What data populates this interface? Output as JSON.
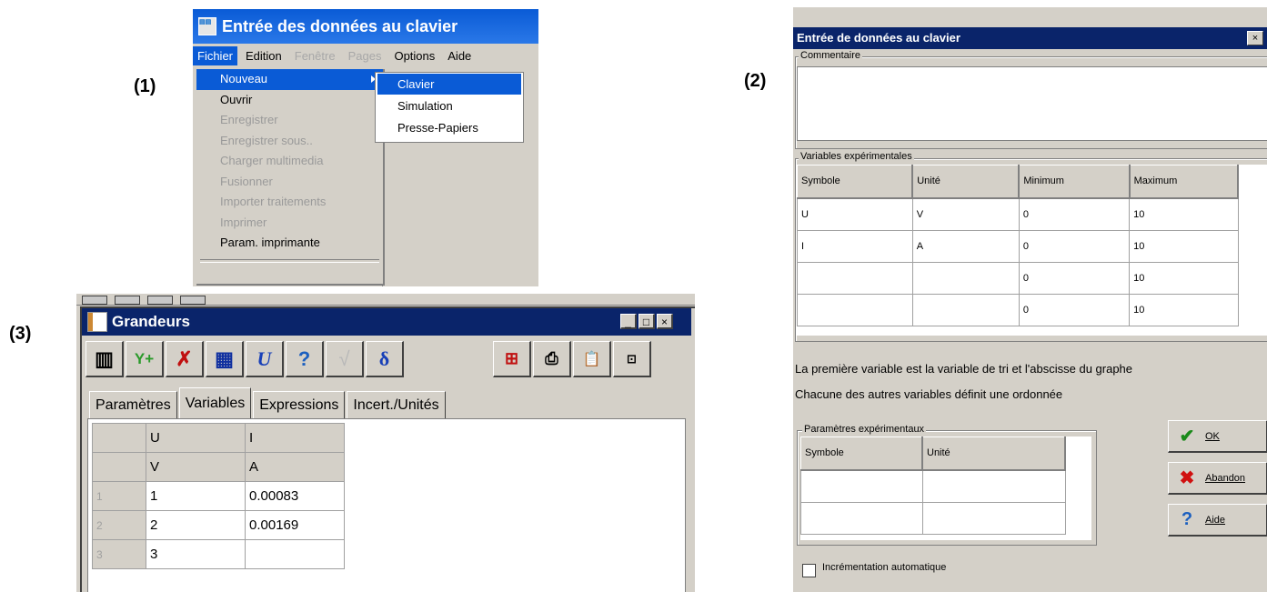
{
  "labels": {
    "panel1": "(1)",
    "panel2": "(2)",
    "panel3": "(3)"
  },
  "panel1": {
    "title": "Entrée des données au clavier",
    "menubar": [
      "Fichier",
      "Edition",
      "Fenêtre",
      "Pages",
      "Options",
      "Aide"
    ],
    "file_menu": [
      "Nouveau",
      "Ouvrir",
      "Enregistrer",
      "Enregistrer sous..",
      "Charger multimedia",
      "Fusionner",
      "Importer traitements",
      "Imprimer",
      "Param. imprimante"
    ],
    "submenu": [
      "Clavier",
      "Simulation",
      "Presse-Papiers"
    ]
  },
  "panel2": {
    "title": "Entrée de données au clavier",
    "close": "×",
    "comment_group": "Commentaire",
    "vars_group": "Variables expérimentales",
    "vars_headers": [
      "Symbole",
      "Unité",
      "Minimum",
      "Maximum"
    ],
    "vars_rows": [
      [
        "U",
        "V",
        "0",
        "10"
      ],
      [
        "I",
        "A",
        "0",
        "10"
      ],
      [
        "",
        "",
        "0",
        "10"
      ],
      [
        "",
        "",
        "0",
        "10"
      ]
    ],
    "info1": "La première variable est la variable de tri et l'abscisse du graphe",
    "info2": "Chacune des autres variables définit une ordonnée",
    "params_group": "Paramètres expérimentaux",
    "params_headers": [
      "Symbole",
      "Unité"
    ],
    "ok": "OK",
    "abandon": "Abandon",
    "aide": "Aide",
    "checkbox_label": "Incrémentation automatique"
  },
  "panel3": {
    "title": "Grandeurs",
    "win_buttons": [
      "_",
      "□",
      "×"
    ],
    "tabs": [
      "Paramètres",
      "Variables",
      "Expressions",
      "Incert./Unités"
    ],
    "headers": [
      "U",
      "I"
    ],
    "units": [
      "V",
      "A"
    ],
    "rows": [
      [
        "1",
        "1",
        "0.00083"
      ],
      [
        "2",
        "2",
        "0.00169"
      ],
      [
        "3",
        "3",
        ""
      ]
    ],
    "toolbar": [
      "Y+",
      "U",
      "?",
      "√",
      "δ",
      "📋"
    ]
  }
}
